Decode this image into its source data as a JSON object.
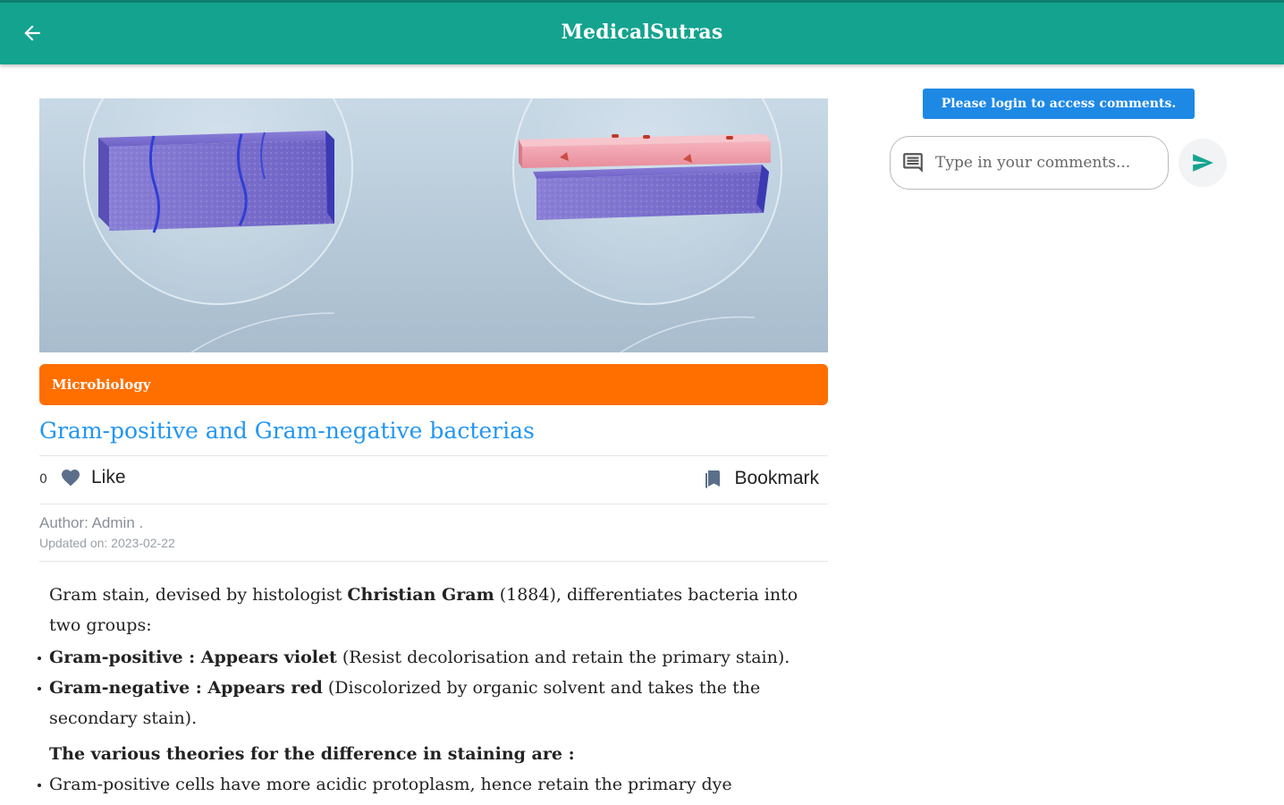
{
  "appbar": {
    "title": "MedicalSutras",
    "back_icon": "arrow-back-icon",
    "background": "#14a38f"
  },
  "article": {
    "category": "Microbiology",
    "category_color": "#ff6f00",
    "title": "Gram-positive and Gram-negative bacterias",
    "title_color": "#2196f3",
    "likes": {
      "count": "0",
      "label": "Like",
      "icon": "heart-icon"
    },
    "bookmark": {
      "label": "Bookmark",
      "icon": "bookmark-icon"
    },
    "author": "Author: Admin .",
    "updated": "Updated on: 2023-02-22",
    "body": {
      "intro": {
        "before": "Gram stain, devised by histologist ",
        "bold": "Christian Gram",
        "after": " (1884), differentiates bacteria into two groups:"
      },
      "groups": [
        {
          "bold": "Gram-positive : Appears violet",
          "rest": " (Resist decolorisation and retain the primary stain)."
        },
        {
          "bold": "Gram-negative : Appears red",
          "rest": " (Discolorized by organic solvent and takes the the secondary stain)."
        }
      ],
      "theories_heading": "The various theories for the difference in staining are :",
      "theories": [
        "Gram-positive cells have more acidic protoplasm, hence retain the primary dye"
      ]
    }
  },
  "comments": {
    "login_notice": "Please login to access comments.",
    "login_color": "#1e88e5",
    "input_placeholder": "Type in your comments...",
    "comment_icon": "comment-icon",
    "send_icon": "send-icon",
    "send_color": "#14a38f"
  }
}
